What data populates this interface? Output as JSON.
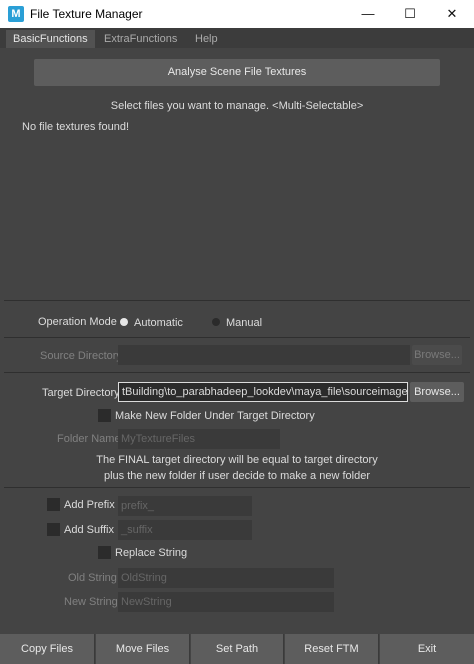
{
  "window": {
    "title": "File Texture Manager",
    "app_icon": "M",
    "minimize": "—",
    "maximize": "☐",
    "close": "✕"
  },
  "tabs": [
    {
      "label": "BasicFunctions",
      "active": true
    },
    {
      "label": "ExtraFunctions",
      "active": false
    },
    {
      "label": "Help",
      "active": false
    }
  ],
  "analyse": {
    "button": "Analyse Scene File Textures",
    "hint": "Select files you want to manage. <Multi-Selectable>",
    "empty": "No file textures found!"
  },
  "operation_mode": {
    "label": "Operation Mode",
    "automatic": "Automatic",
    "manual": "Manual",
    "selected": "Automatic"
  },
  "source_directory": {
    "label": "Source Directory",
    "value": "",
    "browse": "Browse..."
  },
  "target_directory": {
    "label": "Target Directory",
    "value": "tBuilding\\to_parabhadeep_lookdev\\maya_file\\sourceimages\\",
    "browse": "Browse...",
    "make_new_folder": "Make New Folder Under Target Directory",
    "folder_name_label": "Folder Name",
    "folder_name_value": "MyTextureFiles",
    "note_line1": "The FINAL target directory will be equal to target directory",
    "note_line2": "plus the new folder if user decide to make a new folder"
  },
  "rename": {
    "add_prefix": "Add Prefix",
    "prefix_value": "prefix_",
    "add_suffix": "Add Suffix",
    "suffix_value": "_suffix",
    "replace_string": "Replace String",
    "old_string_label": "Old String",
    "old_string_value": "OldString",
    "new_string_label": "New String",
    "new_string_value": "NewString"
  },
  "actions": {
    "copy": "Copy Files",
    "move": "Move Files",
    "set_path": "Set Path",
    "reset": "Reset FTM",
    "exit": "Exit"
  }
}
